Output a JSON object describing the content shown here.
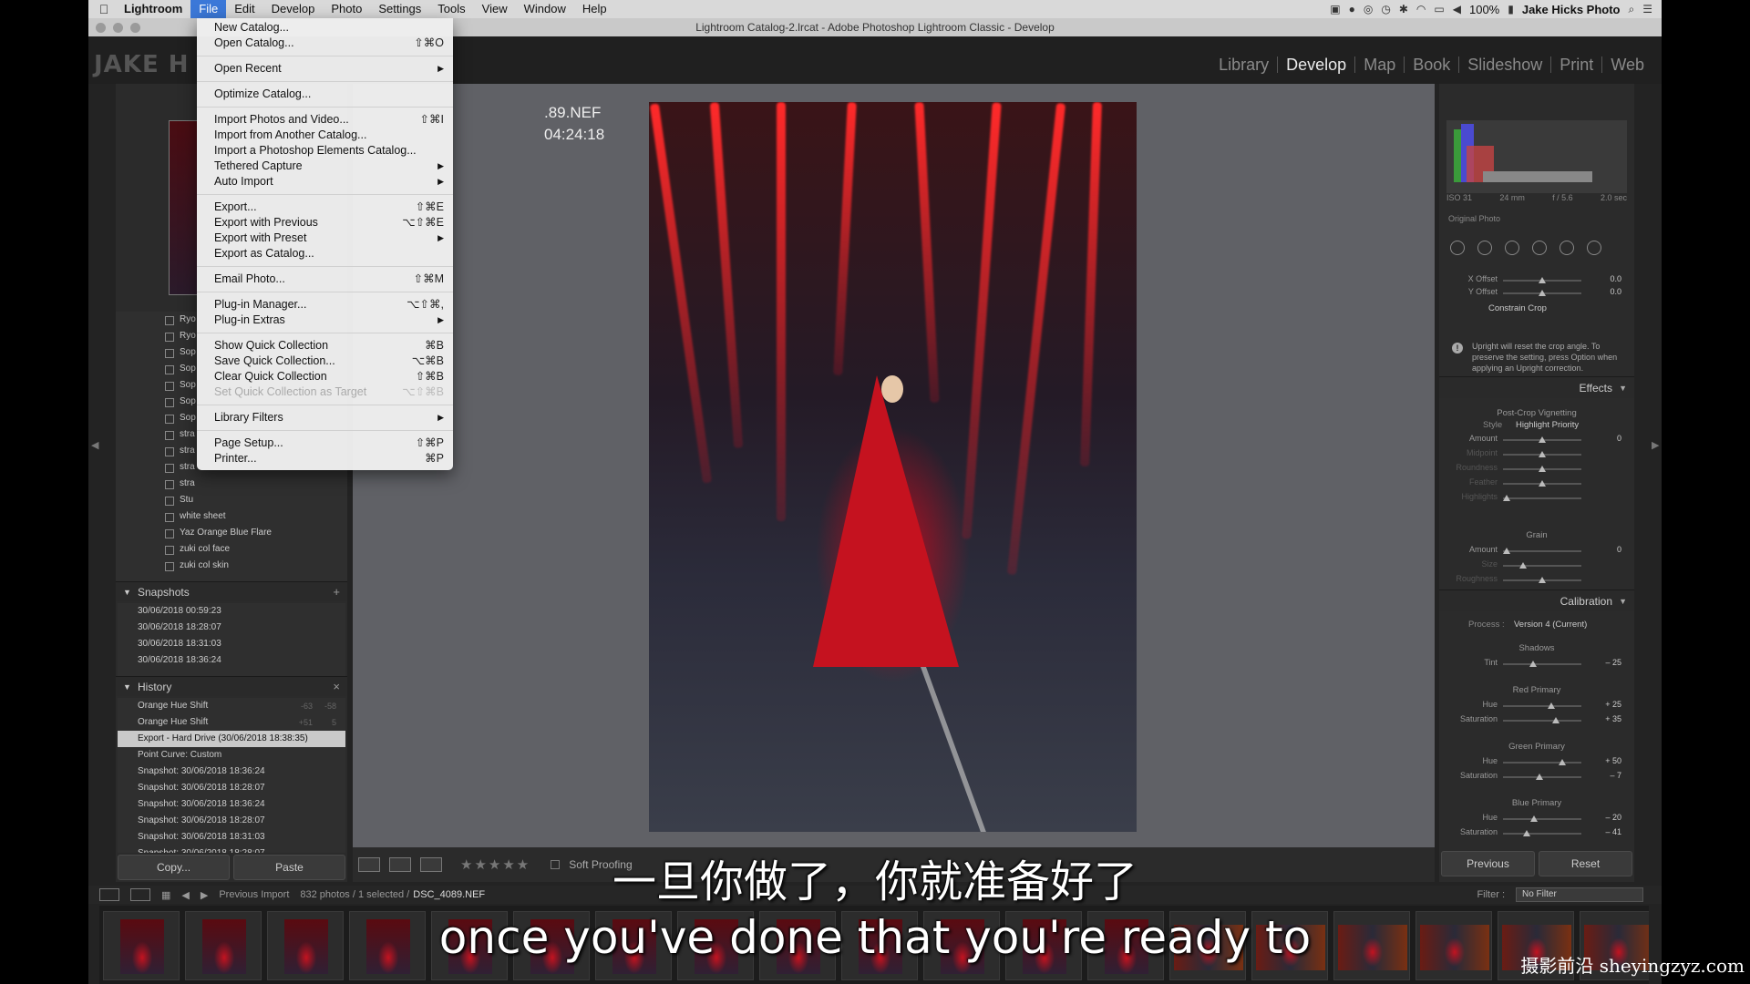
{
  "menubar": {
    "app_name": "Lightroom",
    "items": [
      "File",
      "Edit",
      "Develop",
      "Photo",
      "Settings",
      "Tools",
      "View",
      "Window",
      "Help"
    ],
    "battery": "100%",
    "user": "Jake Hicks Photo"
  },
  "window": {
    "title": "Lightroom Catalog-2.lrcat - Adobe Photoshop Lightroom Classic - Develop"
  },
  "logo_text": "JAKE H",
  "modules": [
    "Library",
    "Develop",
    "Map",
    "Book",
    "Slideshow",
    "Print",
    "Web"
  ],
  "active_module": "Develop",
  "file_menu": {
    "items": [
      {
        "label": "New Catalog...",
        "shortcut": ""
      },
      {
        "label": "Open Catalog...",
        "shortcut": "⇧⌘O"
      },
      {
        "sep": true
      },
      {
        "label": "Open Recent",
        "submenu": true
      },
      {
        "sep": true
      },
      {
        "label": "Optimize Catalog...",
        "shortcut": ""
      },
      {
        "sep": true
      },
      {
        "label": "Import Photos and Video...",
        "shortcut": "⇧⌘I"
      },
      {
        "label": "Import from Another Catalog...",
        "shortcut": ""
      },
      {
        "label": "Import a Photoshop Elements Catalog...",
        "shortcut": ""
      },
      {
        "label": "Tethered Capture",
        "submenu": true
      },
      {
        "label": "Auto Import",
        "submenu": true
      },
      {
        "sep": true
      },
      {
        "label": "Export...",
        "shortcut": "⇧⌘E"
      },
      {
        "label": "Export with Previous",
        "shortcut": "⌥⇧⌘E"
      },
      {
        "label": "Export with Preset",
        "submenu": true
      },
      {
        "label": "Export as Catalog...",
        "shortcut": ""
      },
      {
        "sep": true
      },
      {
        "label": "Email Photo...",
        "shortcut": "⇧⌘M"
      },
      {
        "sep": true
      },
      {
        "label": "Plug-in Manager...",
        "shortcut": "⌥⇧⌘,"
      },
      {
        "label": "Plug-in Extras",
        "submenu": true
      },
      {
        "sep": true
      },
      {
        "label": "Show Quick Collection",
        "shortcut": "⌘B"
      },
      {
        "label": "Save Quick Collection...",
        "shortcut": "⌥⌘B"
      },
      {
        "label": "Clear Quick Collection",
        "shortcut": "⇧⌘B"
      },
      {
        "label": "Set Quick Collection as Target",
        "shortcut": "⌥⇧⌘B",
        "disabled": true
      },
      {
        "sep": true
      },
      {
        "label": "Library Filters",
        "submenu": true
      },
      {
        "sep": true
      },
      {
        "label": "Page Setup...",
        "shortcut": "⇧⌘P"
      },
      {
        "label": "Printer...",
        "shortcut": "⌘P"
      }
    ]
  },
  "info_overlay": {
    "line1": ".89.NEF",
    "line2": "04:24:18"
  },
  "collections": [
    "Ryo",
    "Ryo",
    "Sop",
    "Sop",
    "Sop",
    "Sop",
    "Sop",
    "stra",
    "stra",
    "stra",
    "stra",
    "Stu",
    "white sheet",
    "Yaz Orange Blue Flare",
    "zuki col face",
    "zuki col skin"
  ],
  "snapshots": {
    "title": "Snapshots",
    "add": "+",
    "items": [
      "30/06/2018 00:59:23",
      "30/06/2018 18:28:07",
      "30/06/2018 18:31:03",
      "30/06/2018 18:36:24"
    ]
  },
  "history": {
    "title": "History",
    "close": "×",
    "items": [
      {
        "label": "Orange Hue Shift",
        "v1": "-63",
        "v2": "-58"
      },
      {
        "label": "Orange Hue Shift",
        "v1": "+51",
        "v2": "5"
      },
      {
        "label": "Export - Hard Drive (30/06/2018 18:38:35)",
        "v1": "",
        "v2": "",
        "selected": true
      },
      {
        "label": "Point Curve: Custom",
        "v1": "",
        "v2": ""
      },
      {
        "label": "Snapshot: 30/06/2018 18:36:24",
        "v1": "",
        "v2": ""
      },
      {
        "label": "Snapshot: 30/06/2018 18:28:07",
        "v1": "",
        "v2": ""
      },
      {
        "label": "Snapshot: 30/06/2018 18:36:24",
        "v1": "",
        "v2": ""
      },
      {
        "label": "Snapshot: 30/06/2018 18:28:07",
        "v1": "",
        "v2": ""
      },
      {
        "label": "Snapshot: 30/06/2018 18:31:03",
        "v1": "",
        "v2": ""
      },
      {
        "label": "Snapshot: 30/06/2018 18:28:07",
        "v1": "",
        "v2": ""
      }
    ]
  },
  "left_buttons": {
    "copy": "Copy...",
    "paste": "Paste"
  },
  "toolbar": {
    "stars": "★★★★★",
    "soft_proofing": "Soft Proofing"
  },
  "histogram_meta": {
    "iso": "ISO 31",
    "focal": "24 mm",
    "aperture": "f / 5.6",
    "shutter": "2.0 sec",
    "original": "Original Photo"
  },
  "crop": {
    "x_offset": {
      "label": "X Offset",
      "value": "0.0",
      "pos": 0.5
    },
    "y_offset": {
      "label": "Y Offset",
      "value": "0.0",
      "pos": 0.5
    },
    "constrain": "Constrain Crop",
    "upright_note": "Upright will reset the crop angle. To preserve the setting, press Option when applying an Upright correction."
  },
  "effects": {
    "title": "Effects",
    "vignette_title": "Post-Crop Vignetting",
    "style_label": "Style",
    "style_value": "Highlight Priority",
    "sliders": [
      {
        "label": "Amount",
        "value": "0",
        "pos": 0.5,
        "dim": false
      },
      {
        "label": "Midpoint",
        "value": "",
        "pos": 0.5,
        "dim": true
      },
      {
        "label": "Roundness",
        "value": "",
        "pos": 0.5,
        "dim": true
      },
      {
        "label": "Feather",
        "value": "",
        "pos": 0.5,
        "dim": true
      },
      {
        "label": "Highlights",
        "value": "",
        "pos": 0.05,
        "dim": true
      }
    ],
    "grain_title": "Grain",
    "grain": [
      {
        "label": "Amount",
        "value": "0",
        "pos": 0.05,
        "dim": false
      },
      {
        "label": "Size",
        "value": "",
        "pos": 0.25,
        "dim": true
      },
      {
        "label": "Roughness",
        "value": "",
        "pos": 0.5,
        "dim": true
      }
    ]
  },
  "calibration": {
    "title": "Calibration",
    "process_label": "Process :",
    "process_value": "Version 4 (Current)",
    "groups": [
      {
        "title": "Shadows",
        "sliders": [
          {
            "label": "Tint",
            "value": "– 25",
            "pos": 0.38
          }
        ]
      },
      {
        "title": "Red Primary",
        "sliders": [
          {
            "label": "Hue",
            "value": "+ 25",
            "pos": 0.62
          },
          {
            "label": "Saturation",
            "value": "+ 35",
            "pos": 0.67
          }
        ]
      },
      {
        "title": "Green Primary",
        "sliders": [
          {
            "label": "Hue",
            "value": "+ 50",
            "pos": 0.75
          },
          {
            "label": "Saturation",
            "value": "– 7",
            "pos": 0.46
          }
        ]
      },
      {
        "title": "Blue Primary",
        "sliders": [
          {
            "label": "Hue",
            "value": "– 20",
            "pos": 0.4
          },
          {
            "label": "Saturation",
            "value": "– 41",
            "pos": 0.3
          }
        ]
      }
    ]
  },
  "right_buttons": {
    "previous": "Previous",
    "reset": "Reset"
  },
  "filmstrip": {
    "source": "Previous Import",
    "count": "832 photos / 1 selected /",
    "file": "DSC_4089.NEF",
    "filter_label": "Filter :",
    "filter_value": "No Filter"
  },
  "subtitles": {
    "zh": "一旦你做了，你就准备好了",
    "en": "once you've done that you're ready to"
  },
  "watermark": "摄影前沿 sheyingzyz.com",
  "colors": {
    "menu_highlight": "#3b78d8",
    "dress_red": "#c5121f",
    "panel_bg": "#2b2b2b"
  }
}
